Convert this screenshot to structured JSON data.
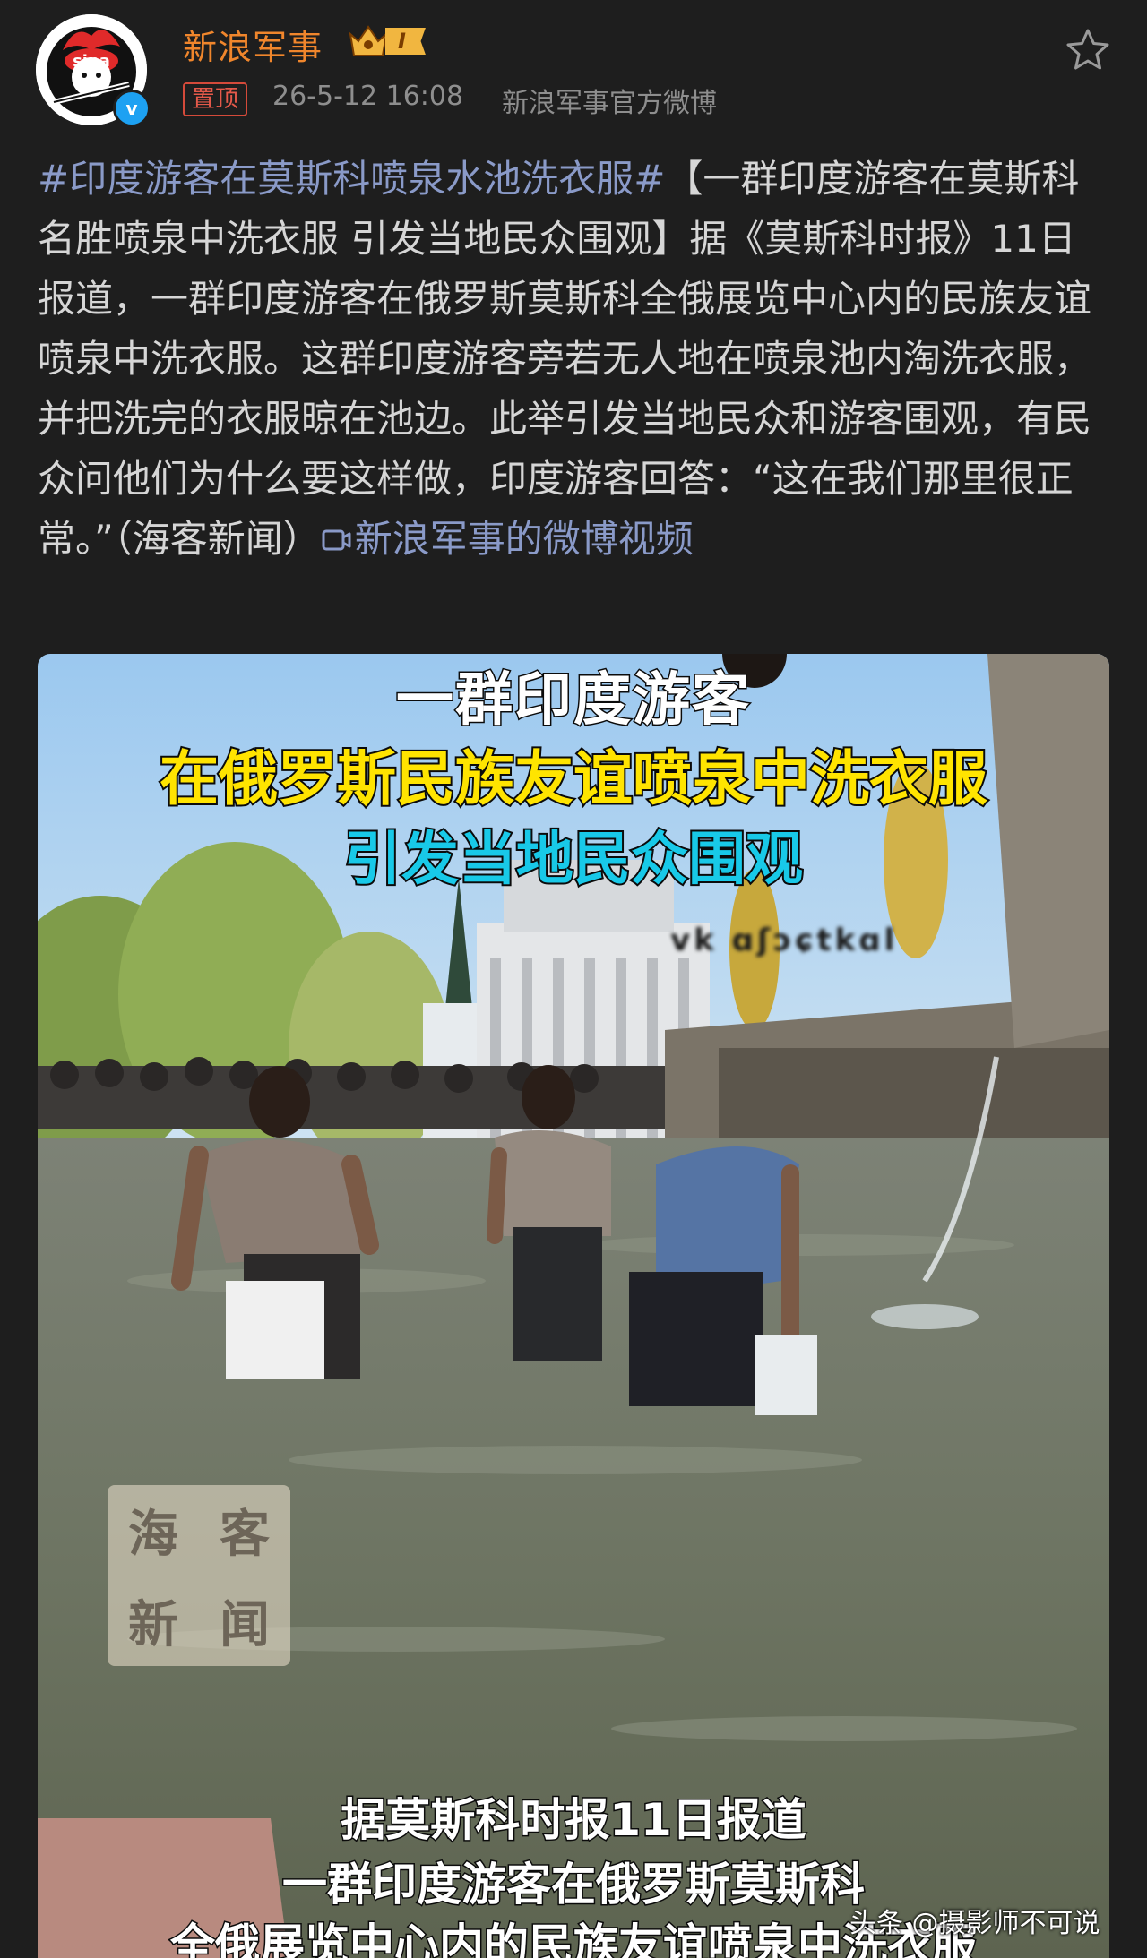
{
  "post": {
    "author": {
      "name": "新浪军事",
      "level": "I",
      "avatar_text": "sina"
    },
    "pin_label": "置顶",
    "time": "26-5-12 16:08",
    "source": "新浪军事官方微博",
    "text": {
      "hashtag": "#印度游客在莫斯科喷泉水池洗衣服#",
      "body": "【一群印度游客在莫斯科名胜喷泉中洗衣服 引发当地民众围观】据《莫斯科时报》11日报道，一群印度游客在俄罗斯莫斯科全俄展览中心内的民族友谊喷泉中洗衣服。这群印度游客旁若无人地在喷泉池内淘洗衣服，并把洗完的衣服晾在池边。此举引发当地民众和游客围观，有民众问他们为什么要这样做，印度游客回答：“这在我们那里很正常。”（海客新闻）",
      "video_link": "新浪军事的微博视频"
    },
    "media": {
      "caption_line1": "一群印度游客",
      "caption_line2": "在俄罗斯民族友谊喷泉中洗衣服",
      "caption_line3": "引发当地民众围观",
      "obscured_text": "vk ɑʃɔɕtkɑl",
      "watermark": [
        "海",
        "客",
        "新",
        "闻"
      ],
      "subtitle_line1": "据莫斯科时报11日报道",
      "subtitle_line2": "一群印度游客在俄罗斯莫斯科",
      "subtitle_line3": "全俄展览中心内的民族友谊喷泉中洗衣服"
    }
  },
  "credit": "头条 @摄影师不可说",
  "icons": {
    "favorite": "star-icon",
    "verified": "verified-icon",
    "video_link": "video-icon",
    "level": "crown-icon"
  },
  "colors": {
    "background": "#1e1e1e",
    "username": "#f0862c",
    "link": "#8a9ac8",
    "meta": "#8e8e8e",
    "pin": "#e5594a"
  }
}
